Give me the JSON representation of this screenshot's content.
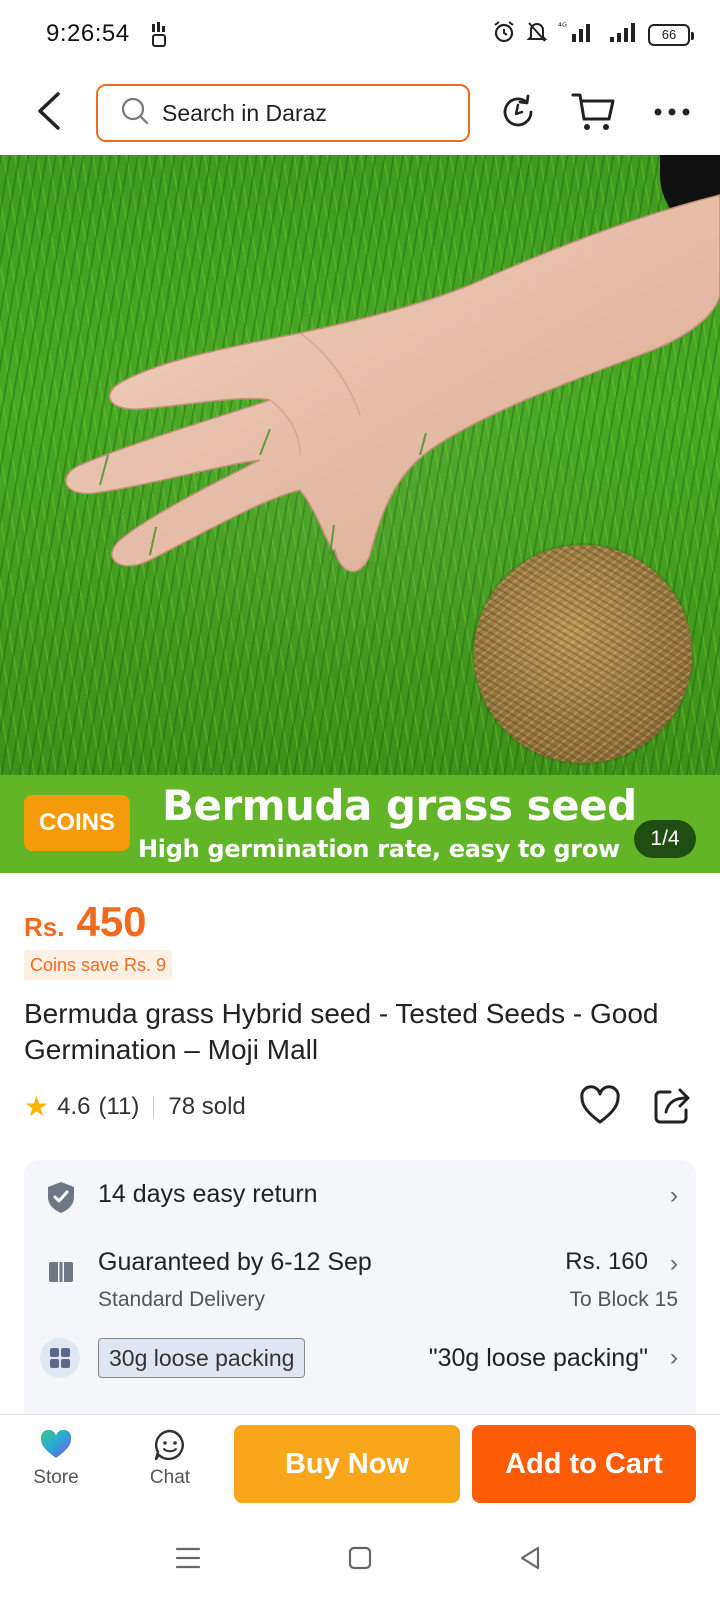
{
  "status_bar": {
    "time": "9:26:54",
    "battery": "66"
  },
  "top_nav": {
    "search_placeholder": "Search in Daraz"
  },
  "hero": {
    "coins_badge": "COINS",
    "promo_title": "Bermuda grass seed",
    "promo_subtitle": "High germination rate, easy to grow",
    "page_indicator": "1/4"
  },
  "price": {
    "currency": "Rs.",
    "value": "450",
    "coins_save": "Coins save Rs. 9"
  },
  "product": {
    "title": "Bermuda grass Hybrid seed - Tested Seeds - Good Germination – Moji Mall",
    "rating": "4.6",
    "reviews": "(11)",
    "sold": "78 sold"
  },
  "info": {
    "return_text": "14 days easy return",
    "delivery_text": "Guaranteed by 6-12 Sep",
    "delivery_type": "Standard Delivery",
    "shipping_fee": "Rs. 160",
    "shipping_dest": "To Block 15",
    "variant_chip": "30g loose packing",
    "variant_value": "\"30g loose packing\""
  },
  "action_bar": {
    "store_label": "Store",
    "chat_label": "Chat",
    "buy_now": "Buy Now",
    "add_to_cart": "Add to Cart"
  },
  "colors": {
    "accent": "#f36a1c",
    "buy_now": "#faa61a",
    "add_to_cart": "#fc5c06",
    "promo_green": "#62b526",
    "coins": "#f59a08"
  }
}
